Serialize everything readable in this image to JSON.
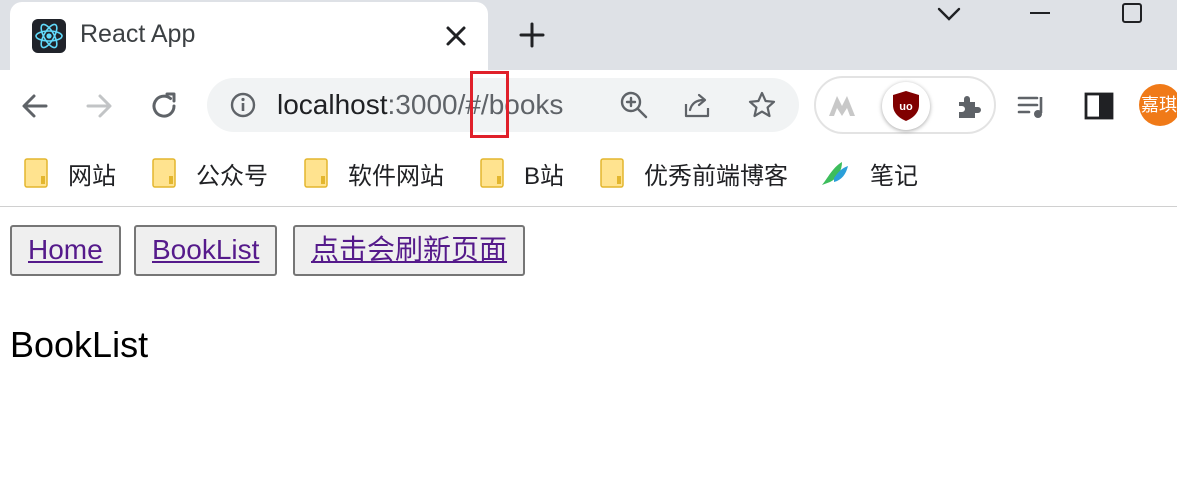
{
  "browser": {
    "tab_title": "React App",
    "url_host": "localhost",
    "url_rest": ":3000/#/books",
    "avatar_text": "嘉琪"
  },
  "bookmarks": [
    {
      "label": "网站"
    },
    {
      "label": "公众号"
    },
    {
      "label": "软件网站"
    },
    {
      "label": "B站"
    },
    {
      "label": "优秀前端博客"
    },
    {
      "label": "笔记"
    }
  ],
  "page": {
    "links": [
      {
        "label": "Home"
      },
      {
        "label": "BookList"
      },
      {
        "label": "点击会刷新页面"
      }
    ],
    "content_text": "BookList"
  },
  "colors": {
    "tabstrip": "#dee1e6",
    "omnibox": "#f1f3f4",
    "highlight": "#e0202a",
    "avatar": "#f07a18",
    "visited_link": "#551a8b"
  }
}
